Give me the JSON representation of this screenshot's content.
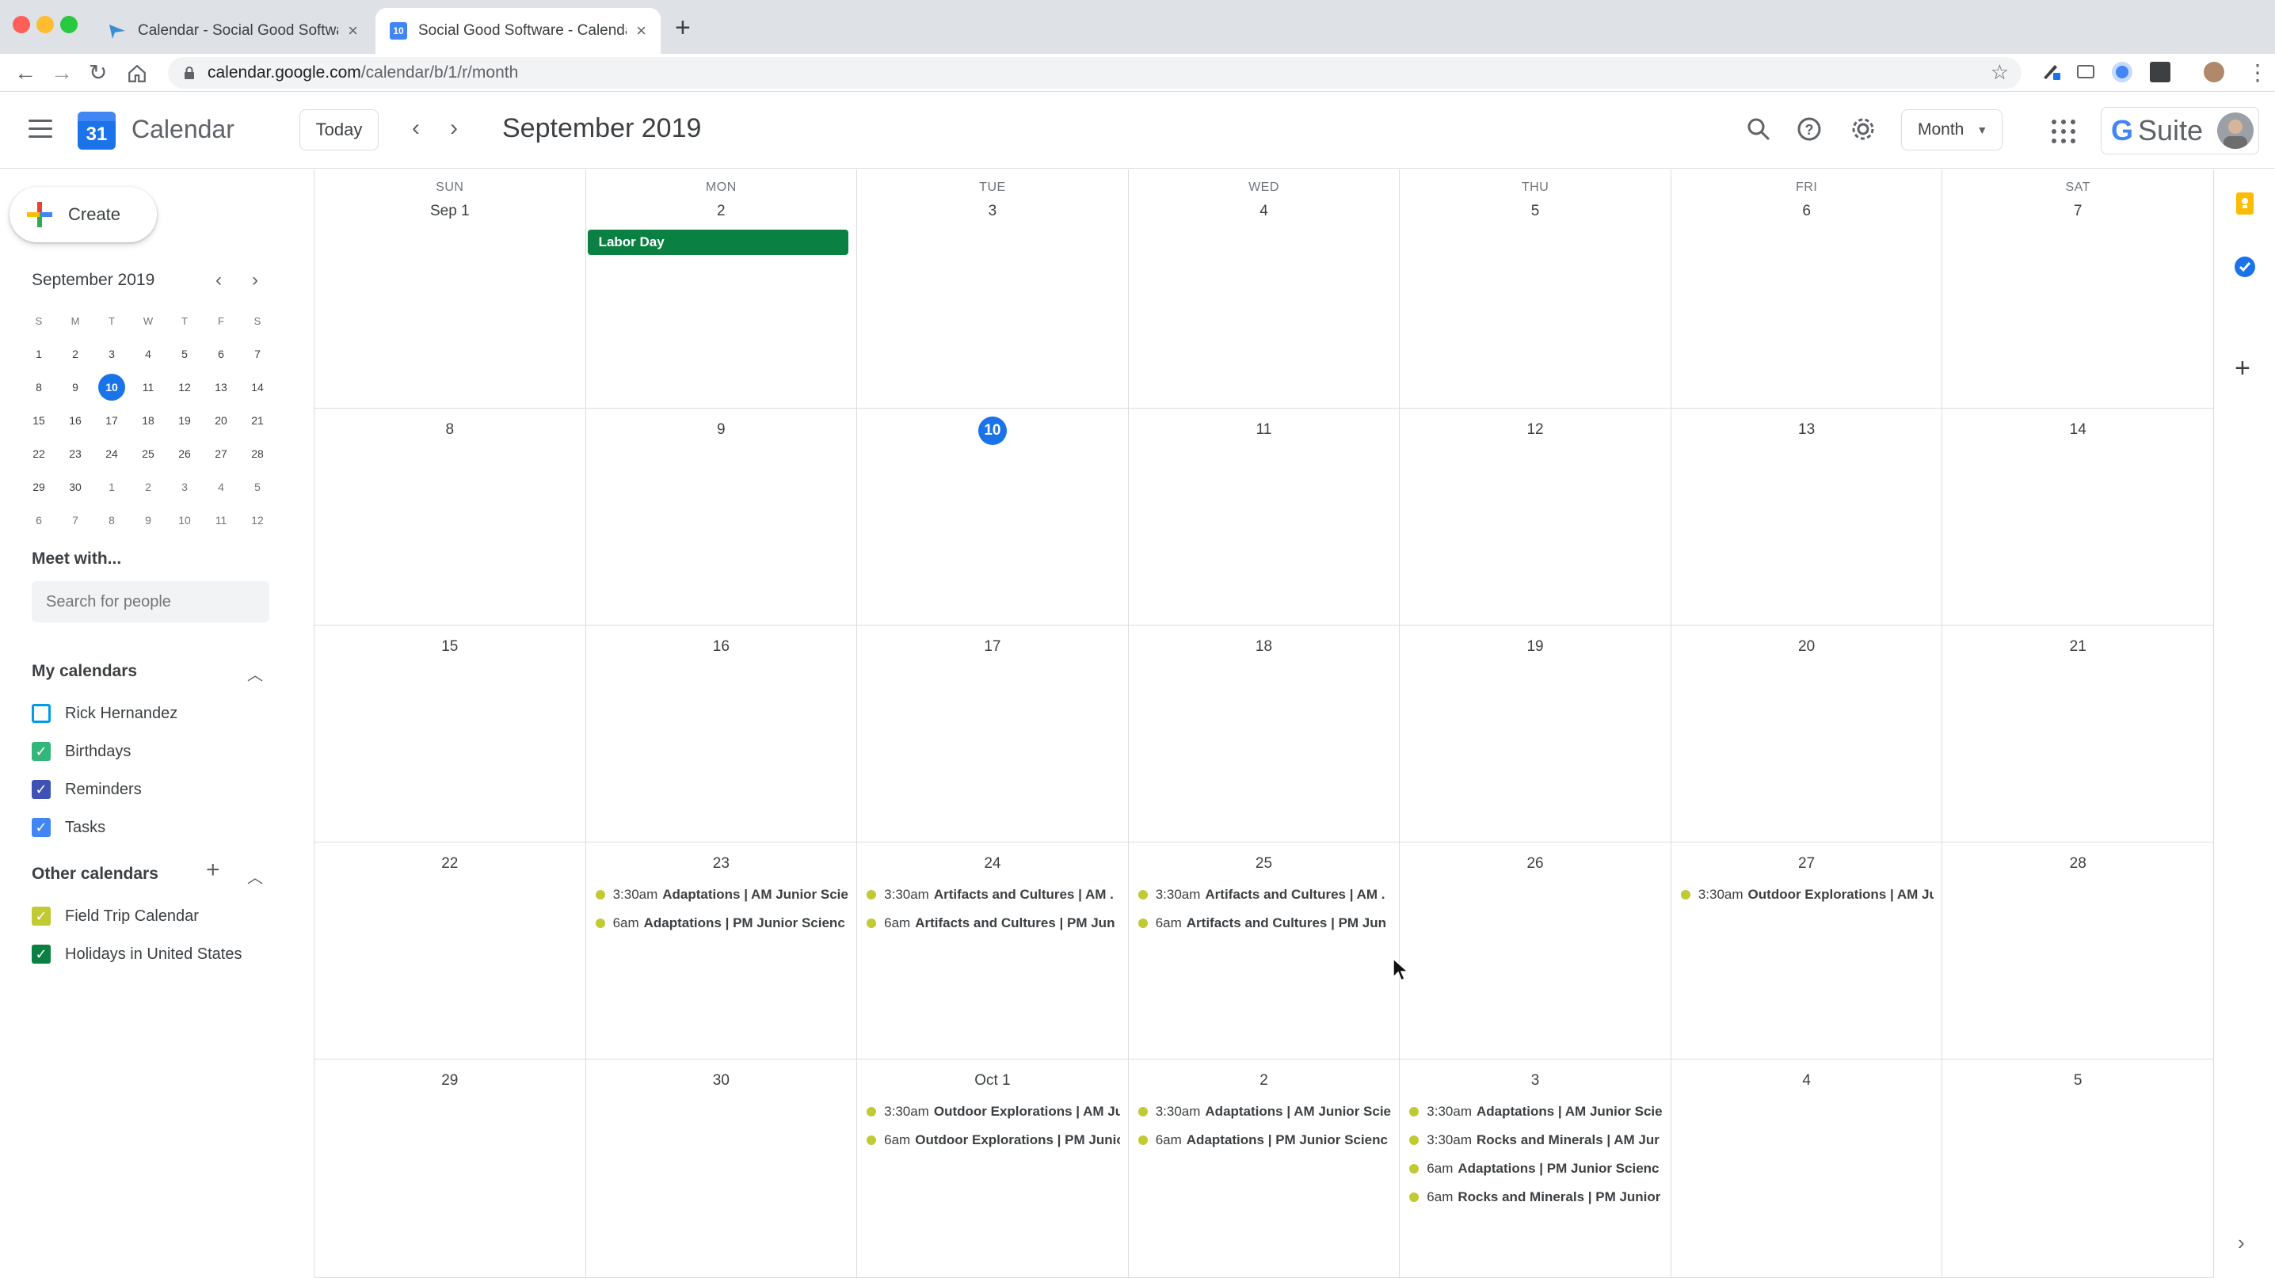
{
  "browser": {
    "tabs": [
      {
        "title": "Calendar - Social Good Software"
      },
      {
        "title": "Social Good Software - Calendar"
      }
    ],
    "url_host": "calendar.google.com",
    "url_path": "/calendar/b/1/r/month",
    "favicon_day": "10"
  },
  "header": {
    "app_name": "Calendar",
    "logo_day": "31",
    "today_label": "Today",
    "month_title": "September 2019",
    "view_label": "Month",
    "brand": "Suite",
    "brand_g": "G"
  },
  "sidebar": {
    "create_label": "Create",
    "mini_title": "September 2019",
    "weekday_initials": [
      "S",
      "M",
      "T",
      "W",
      "T",
      "F",
      "S"
    ],
    "meet_title": "Meet with...",
    "search_placeholder": "Search for people",
    "my_calendars_title": "My calendars",
    "my_calendars": [
      {
        "name": "Rick Hernandez",
        "checked": false,
        "color": "#039be5"
      },
      {
        "name": "Birthdays",
        "checked": true,
        "color": "#33b679"
      },
      {
        "name": "Reminders",
        "checked": true,
        "color": "#3f51b5"
      },
      {
        "name": "Tasks",
        "checked": true,
        "color": "#4285f4"
      }
    ],
    "other_calendars_title": "Other calendars",
    "other_calendars": [
      {
        "name": "Field Trip Calendar",
        "checked": true,
        "color": "#c0ca33"
      },
      {
        "name": "Holidays in United States",
        "checked": true,
        "color": "#0b8043"
      }
    ]
  },
  "mini_calendar": [
    [
      {
        "d": "1"
      },
      {
        "d": "2"
      },
      {
        "d": "3"
      },
      {
        "d": "4"
      },
      {
        "d": "5"
      },
      {
        "d": "6"
      },
      {
        "d": "7"
      }
    ],
    [
      {
        "d": "8"
      },
      {
        "d": "9"
      },
      {
        "d": "10",
        "selected": true
      },
      {
        "d": "11"
      },
      {
        "d": "12"
      },
      {
        "d": "13"
      },
      {
        "d": "14"
      }
    ],
    [
      {
        "d": "15"
      },
      {
        "d": "16"
      },
      {
        "d": "17"
      },
      {
        "d": "18"
      },
      {
        "d": "19"
      },
      {
        "d": "20"
      },
      {
        "d": "21"
      }
    ],
    [
      {
        "d": "22"
      },
      {
        "d": "23"
      },
      {
        "d": "24"
      },
      {
        "d": "25"
      },
      {
        "d": "26"
      },
      {
        "d": "27"
      },
      {
        "d": "28"
      }
    ],
    [
      {
        "d": "29"
      },
      {
        "d": "30"
      },
      {
        "d": "1",
        "other": true
      },
      {
        "d": "2",
        "other": true
      },
      {
        "d": "3",
        "other": true
      },
      {
        "d": "4",
        "other": true
      },
      {
        "d": "5",
        "other": true
      }
    ],
    [
      {
        "d": "6",
        "other": true
      },
      {
        "d": "7",
        "other": true
      },
      {
        "d": "8",
        "other": true
      },
      {
        "d": "9",
        "other": true
      },
      {
        "d": "10",
        "other": true
      },
      {
        "d": "11",
        "other": true
      },
      {
        "d": "12",
        "other": true
      }
    ]
  ],
  "calendar": {
    "weekdays": [
      "SUN",
      "MON",
      "TUE",
      "WED",
      "THU",
      "FRI",
      "SAT"
    ],
    "weeks": [
      [
        {
          "label": "Sep 1",
          "events": []
        },
        {
          "label": "2",
          "allday": "Labor Day",
          "events": []
        },
        {
          "label": "3",
          "events": []
        },
        {
          "label": "4",
          "events": []
        },
        {
          "label": "5",
          "events": []
        },
        {
          "label": "6",
          "events": []
        },
        {
          "label": "7",
          "events": []
        }
      ],
      [
        {
          "label": "8",
          "events": []
        },
        {
          "label": "9",
          "events": []
        },
        {
          "label": "10",
          "today": true,
          "events": []
        },
        {
          "label": "11",
          "events": []
        },
        {
          "label": "12",
          "events": []
        },
        {
          "label": "13",
          "events": []
        },
        {
          "label": "14",
          "events": []
        }
      ],
      [
        {
          "label": "15",
          "events": []
        },
        {
          "label": "16",
          "events": []
        },
        {
          "label": "17",
          "events": []
        },
        {
          "label": "18",
          "events": []
        },
        {
          "label": "19",
          "events": []
        },
        {
          "label": "20",
          "events": []
        },
        {
          "label": "21",
          "events": []
        }
      ],
      [
        {
          "label": "22",
          "events": []
        },
        {
          "label": "23",
          "events": [
            {
              "time": "3:30am",
              "title": "Adaptations | AM Junior Scie"
            },
            {
              "time": "6am",
              "title": "Adaptations | PM Junior Scienc"
            }
          ]
        },
        {
          "label": "24",
          "events": [
            {
              "time": "3:30am",
              "title": "Artifacts and Cultures | AM ."
            },
            {
              "time": "6am",
              "title": "Artifacts and Cultures | PM Jun"
            }
          ]
        },
        {
          "label": "25",
          "events": [
            {
              "time": "3:30am",
              "title": "Artifacts and Cultures | AM ."
            },
            {
              "time": "6am",
              "title": "Artifacts and Cultures | PM Jun"
            }
          ]
        },
        {
          "label": "26",
          "events": []
        },
        {
          "label": "27",
          "events": [
            {
              "time": "3:30am",
              "title": "Outdoor Explorations | AM Ju"
            }
          ]
        },
        {
          "label": "28",
          "events": []
        }
      ],
      [
        {
          "label": "29",
          "events": []
        },
        {
          "label": "30",
          "events": []
        },
        {
          "label": "Oct 1",
          "events": [
            {
              "time": "3:30am",
              "title": "Outdoor Explorations | AM Ju"
            },
            {
              "time": "6am",
              "title": "Outdoor Explorations | PM Junio"
            }
          ]
        },
        {
          "label": "2",
          "events": [
            {
              "time": "3:30am",
              "title": "Adaptations | AM Junior Scie"
            },
            {
              "time": "6am",
              "title": "Adaptations | PM Junior Scienc"
            }
          ]
        },
        {
          "label": "3",
          "events": [
            {
              "time": "3:30am",
              "title": "Adaptations | AM Junior Scie"
            },
            {
              "time": "3:30am",
              "title": "Rocks and Minerals | AM Jur"
            },
            {
              "time": "6am",
              "title": "Adaptations | PM Junior Scienc"
            },
            {
              "time": "6am",
              "title": "Rocks and Minerals | PM Junior"
            }
          ]
        },
        {
          "label": "4",
          "events": []
        },
        {
          "label": "5",
          "events": []
        }
      ]
    ]
  },
  "colors": {
    "accent": "#1a73e8",
    "holiday": "#0b8043",
    "field_trip": "#c0ca33"
  }
}
